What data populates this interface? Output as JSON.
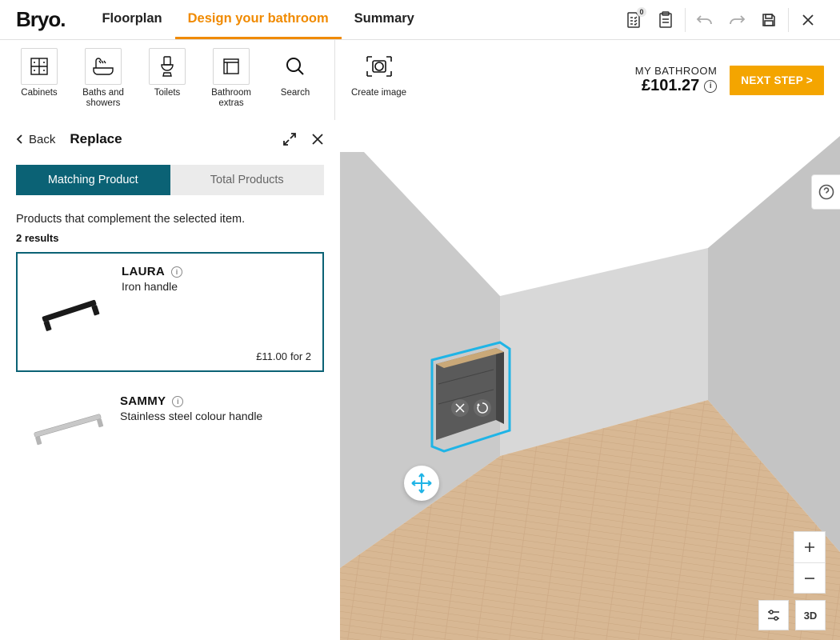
{
  "logo": "Bryo.",
  "nav": [
    {
      "label": "Floorplan",
      "active": false
    },
    {
      "label": "Design your bathroom",
      "active": true
    },
    {
      "label": "Summary",
      "active": false
    }
  ],
  "header_badge": "0",
  "categories": [
    {
      "label": "Cabinets",
      "icon": "cabinet"
    },
    {
      "label": "Baths and showers",
      "icon": "bath"
    },
    {
      "label": "Toilets",
      "icon": "toilet"
    },
    {
      "label": "Bathroom extras",
      "icon": "towel"
    },
    {
      "label": "Search",
      "icon": "search"
    }
  ],
  "create_image_label": "Create image",
  "project": {
    "name": "MY BATHROOM",
    "price": "£101.27"
  },
  "next_btn": "NEXT STEP >",
  "panel": {
    "back": "Back",
    "title": "Replace",
    "tabs": [
      {
        "label": "Matching Product",
        "active": true
      },
      {
        "label": "Total Products",
        "active": false
      }
    ],
    "description": "Products that complement the selected item.",
    "results_label": "2 results"
  },
  "products": [
    {
      "name": "LAURA",
      "desc": "Iron handle",
      "price": "£11.00",
      "for": "for 2",
      "selected": true,
      "thumb": "handle-black"
    },
    {
      "name": "SAMMY",
      "desc": "Stainless steel colour handle",
      "price": "",
      "for": "",
      "selected": false,
      "thumb": "handle-steel"
    }
  ],
  "view_3d_label": "3D"
}
